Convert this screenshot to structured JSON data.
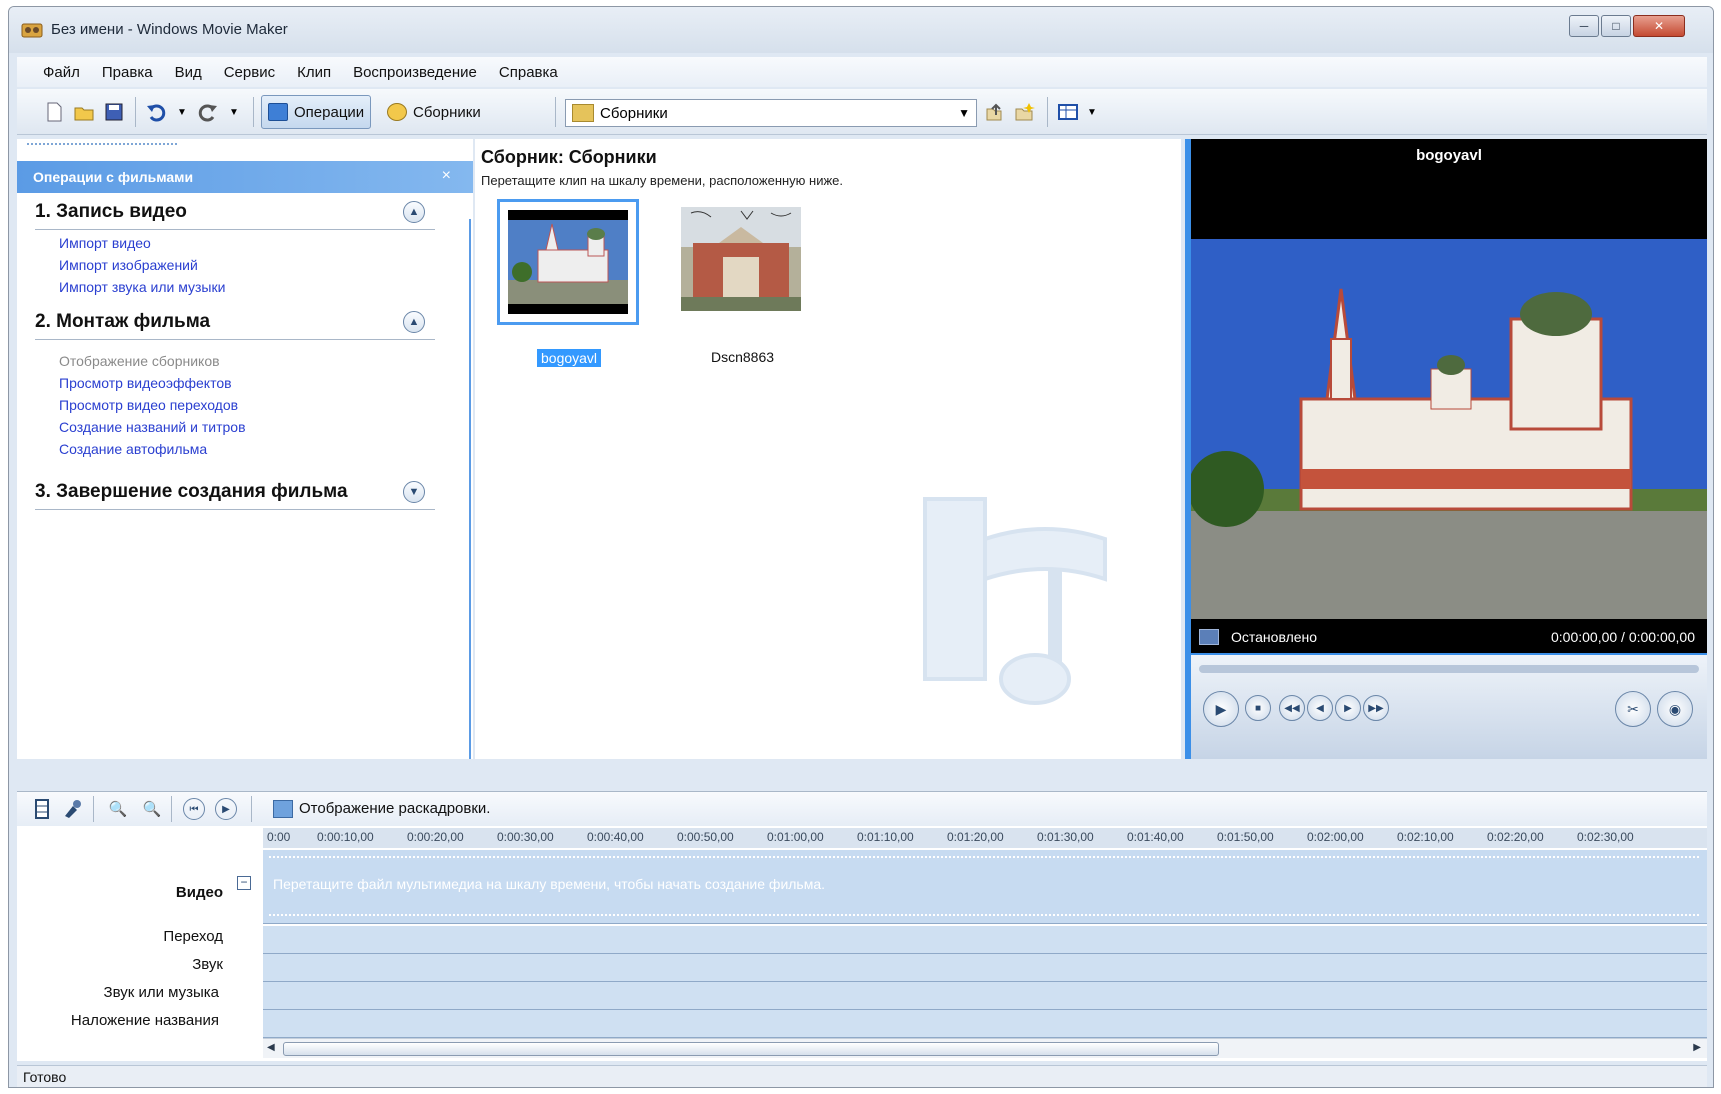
{
  "window": {
    "title": "Без имени - Windows Movie Maker",
    "controls": {
      "minimize": "─",
      "maximize": "□",
      "close": "✕"
    }
  },
  "menu": [
    "Файл",
    "Правка",
    "Вид",
    "Сервис",
    "Клип",
    "Воспроизведение",
    "Справка"
  ],
  "toolbar": {
    "operations_label": "Операции",
    "collections_label": "Сборники",
    "collection_select_value": "Сборники"
  },
  "tasks": {
    "header": "Операции с фильмами",
    "close": "×",
    "sections": [
      {
        "title": "1. Запись видео",
        "items": [
          {
            "label": "Импорт видео",
            "disabled": false
          },
          {
            "label": "Импорт изображений",
            "disabled": false
          },
          {
            "label": "Импорт звука или музыки",
            "disabled": false
          }
        ]
      },
      {
        "title": "2. Монтаж фильма",
        "items": [
          {
            "label": "Отображение сборников",
            "disabled": true
          },
          {
            "label": "Просмотр видеоэффектов",
            "disabled": false
          },
          {
            "label": "Просмотр видео переходов",
            "disabled": false
          },
          {
            "label": "Создание названий и титров",
            "disabled": false
          },
          {
            "label": "Создание автофильма",
            "disabled": false
          }
        ]
      },
      {
        "title": "3. Завершение создания фильма",
        "items": []
      }
    ]
  },
  "collection": {
    "title": "Сборник: Сборники",
    "hint": "Перетащите клип на шкалу времени, расположенную ниже.",
    "clips": [
      {
        "name": "bogoyavl",
        "selected": true
      },
      {
        "name": "Dscn8863",
        "selected": false
      }
    ]
  },
  "preview": {
    "title": "bogoyavl",
    "status": "Остановлено",
    "time": "0:00:00,00 / 0:00:00,00"
  },
  "timeline": {
    "mode_label": "Отображение раскадровки.",
    "ruler_ticks": [
      "0:00",
      "0:00:10,00",
      "0:00:20,00",
      "0:00:30,00",
      "0:00:40,00",
      "0:00:50,00",
      "0:01:00,00",
      "0:01:10,00",
      "0:01:20,00",
      "0:01:30,00",
      "0:01:40,00",
      "0:01:50,00",
      "0:02:00,00",
      "0:02:10,00",
      "0:02:20,00",
      "0:02:30,00"
    ],
    "video_hint": "Перетащите файл мультимедиа на шкалу времени, чтобы начать создание фильма.",
    "tracks": {
      "video": "Видео",
      "transition": "Переход",
      "audio": "Звук",
      "audio_music": "Звук или музыка",
      "title_overlay": "Наложение названия"
    }
  },
  "statusbar": "Готово",
  "colors": {
    "accent": "#3b8fe8",
    "link": "#2a3fd0",
    "selection": "#3399ff"
  }
}
